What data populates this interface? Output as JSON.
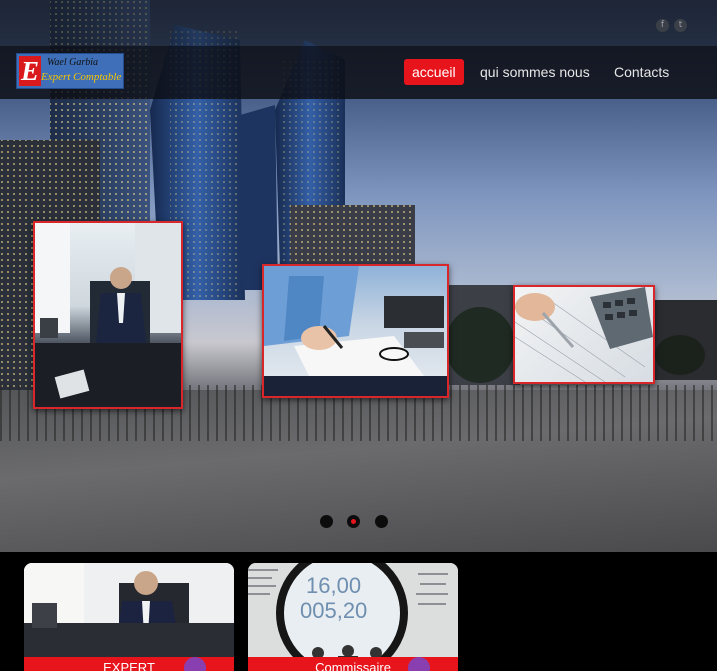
{
  "brand": {
    "line1": "Wael Garbia",
    "line2": "Expert Comptable",
    "mark": "E"
  },
  "social": [
    {
      "icon": "facebook-icon",
      "glyph": "f"
    },
    {
      "icon": "twitter-icon",
      "glyph": "t"
    }
  ],
  "nav": [
    {
      "label": "accueil",
      "active": true
    },
    {
      "label": "qui sommes nous",
      "active": false
    },
    {
      "label": "Contacts",
      "active": false
    }
  ],
  "slider": {
    "slides": 3,
    "active_index": 1
  },
  "cards": [
    {
      "label": "EXPERT"
    },
    {
      "label": "Commissaire"
    }
  ],
  "colors": {
    "accent": "#e8141b",
    "card_arrow": "#8a3fb0",
    "logo_bg": "#3e6fb8"
  }
}
